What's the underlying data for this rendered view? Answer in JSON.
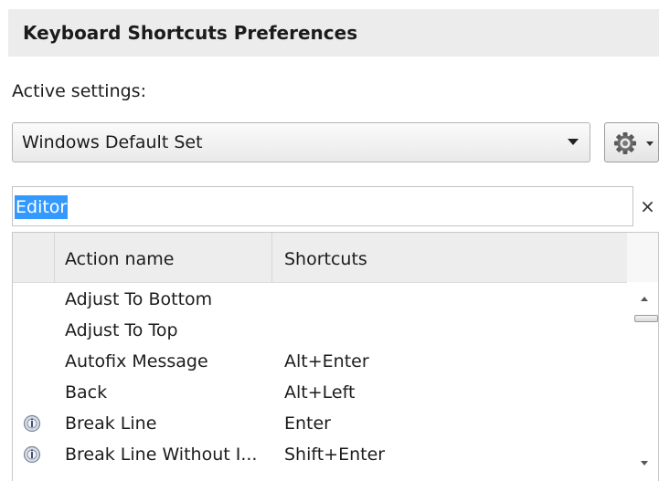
{
  "header": {
    "title": "Keyboard Shortcuts Preferences"
  },
  "active_settings": {
    "label": "Active settings:",
    "selected": "Windows Default Set"
  },
  "filter": {
    "value": "Editor",
    "clear_label": "×"
  },
  "table": {
    "columns": [
      "Action name",
      "Shortcuts"
    ],
    "rows": [
      {
        "name": "Adjust To Bottom",
        "shortcut": "",
        "icon": ""
      },
      {
        "name": "Adjust To Top",
        "shortcut": "",
        "icon": ""
      },
      {
        "name": "Autofix Message",
        "shortcut": "Alt+Enter",
        "icon": ""
      },
      {
        "name": "Back",
        "shortcut": "Alt+Left",
        "icon": ""
      },
      {
        "name": "Break Line",
        "shortcut": "Enter",
        "icon": "info-icon"
      },
      {
        "name": "Break Line Without I...",
        "shortcut": "Shift+Enter",
        "icon": "info-icon"
      }
    ]
  },
  "colors": {
    "selection": "#3399ff",
    "header_bg": "#ececec"
  }
}
